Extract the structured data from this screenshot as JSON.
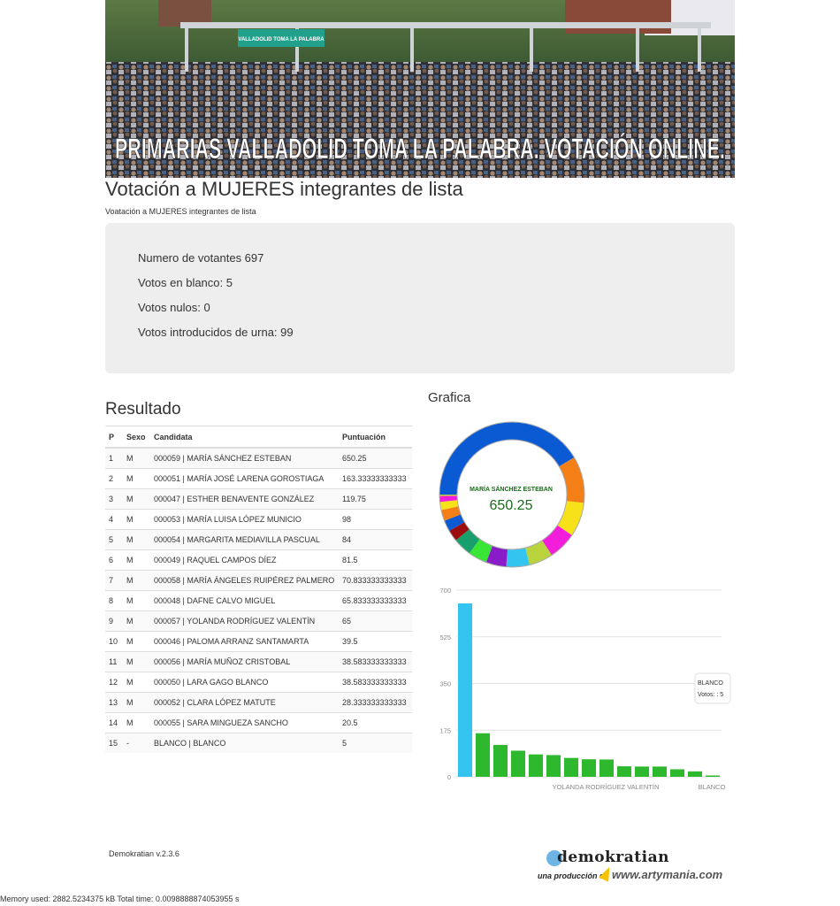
{
  "banner": {
    "title": "PRIMARIAS VALLADOLID TOMA LA PALABRA. VOTACIÓN ONLINE.",
    "sign": "VALLADOLID TOMA LA PALABRA"
  },
  "page": {
    "title": "Votación a MUJERES integrantes de lista",
    "subtitle": "Voatación a MUJERES integrantes de lista"
  },
  "stats": {
    "voters": "Numero de votantes 697",
    "blank": "Votos en blanco: 5",
    "null": "Votos nulos: 0",
    "urn": "Votos introducidos de urna: 99"
  },
  "results": {
    "title": "Resultado",
    "columns": [
      "P",
      "Sexo",
      "Candidata",
      "Puntuación"
    ],
    "rows": [
      [
        "1",
        "M",
        "000059 | MARÍA SÁNCHEZ ESTEBAN",
        "650.25"
      ],
      [
        "2",
        "M",
        "000051 | MARÍA JOSÉ LARENA GOROSTIAGA",
        "163.33333333333"
      ],
      [
        "3",
        "M",
        "000047 | ESTHER BENAVENTE GONZÁLEZ",
        "119.75"
      ],
      [
        "4",
        "M",
        "000053 | MARÍA LUISA LÓPEZ MUNICIO",
        "98"
      ],
      [
        "5",
        "M",
        "000054 | MARGARITA MEDIAVILLA PASCUAL",
        "84"
      ],
      [
        "6",
        "M",
        "000049 | RAQUEL CAMPOS DÍEZ",
        "81.5"
      ],
      [
        "7",
        "M",
        "000058 | MARÍA ÁNGELES RUIPÉREZ PALMERO",
        "70.833333333333"
      ],
      [
        "8",
        "M",
        "000048 | DAFNE CALVO MIGUEL",
        "65.833333333333"
      ],
      [
        "9",
        "M",
        "000057 | YOLANDA RODRÍGUEZ VALENTÍN",
        "65"
      ],
      [
        "10",
        "M",
        "000046 | PALOMA ARRANZ SANTAMARTA",
        "39.5"
      ],
      [
        "11",
        "M",
        "000056 | MARÍA MUÑOZ CRISTOBAL",
        "38.583333333333"
      ],
      [
        "12",
        "M",
        "000050 | LARA GAGO BLANCO",
        "38.583333333333"
      ],
      [
        "13",
        "M",
        "000052 | CLARA LÓPEZ MATUTE",
        "28.333333333333"
      ],
      [
        "14",
        "M",
        "000055 | SARA MINGUEZA SANCHO",
        "20.5"
      ],
      [
        "15",
        "-",
        "BLANCO | BLANCO",
        "5"
      ]
    ]
  },
  "chart_section": {
    "title": "Grafica"
  },
  "chart_data": [
    {
      "type": "pie",
      "center_label": "MARÍA SÁNCHEZ ESTEBAN",
      "center_value": "650.25",
      "values": [
        650.25,
        163.33,
        119.75,
        98,
        84,
        81.5,
        70.83,
        65.83,
        65,
        39.5,
        38.58,
        38.58,
        28.33,
        20.5,
        5
      ],
      "colors": [
        "#0a5bd3",
        "#f57f17",
        "#f7e119",
        "#f21ddb",
        "#b9d33c",
        "#33c5ef",
        "#8a1bc9",
        "#39e535",
        "#17a06b",
        "#9c0d0d",
        "#0a5bd3",
        "#f57f17",
        "#f7e119",
        "#f21ddb",
        "#b9d33c"
      ]
    },
    {
      "type": "bar",
      "values": [
        650.25,
        163.33,
        119.75,
        98,
        84,
        81.5,
        70.83,
        65.83,
        65,
        39.5,
        38.58,
        38.58,
        28.33,
        20.5,
        5
      ],
      "colors": [
        "#33c5ef",
        "#2db82d"
      ],
      "ylim": [
        0,
        700
      ],
      "yticks": [
        "0",
        "175",
        "350",
        "525",
        "700"
      ],
      "xtick_labels": [
        "YOLANDA RODRÍGUEZ VALENTÍN",
        "BLANCO"
      ],
      "tooltip": {
        "name": "BLANCO",
        "text": "Votos: : 5"
      }
    }
  ],
  "footer": {
    "version": "Demokratian v.2.3.6",
    "logo": "demokratian",
    "logo_sub": "una producción de",
    "logo_url": "www.artymania.com",
    "memory": "Memory used: 2882.5234375 kB Total time: 0.0098888874053955 s"
  }
}
